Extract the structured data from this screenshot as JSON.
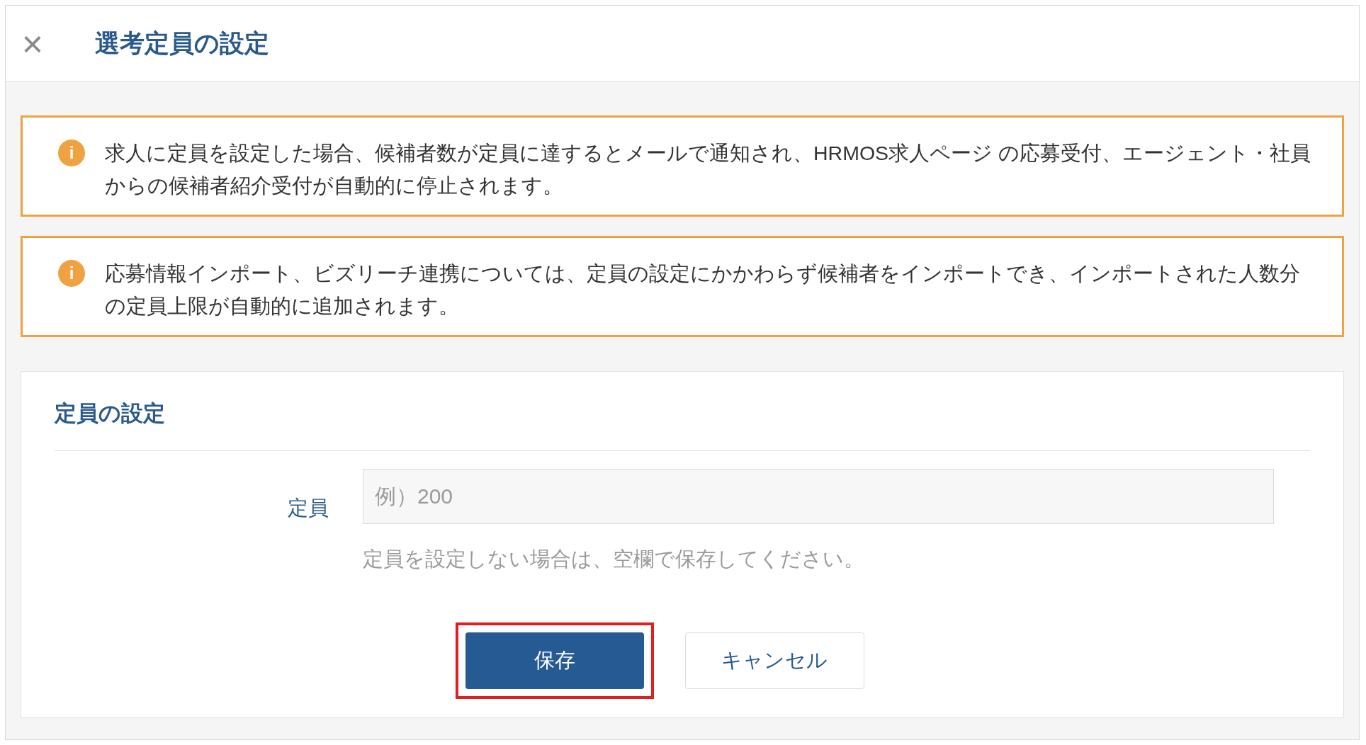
{
  "header": {
    "close": "×",
    "title": "選考定員の設定"
  },
  "notices": [
    {
      "icon": "i",
      "text": "求人に定員を設定した場合、候補者数が定員に達するとメールで通知され、HRMOS求人ページ の応募受付、エージェント・社員からの候補者紹介受付が自動的に停止されます。"
    },
    {
      "icon": "i",
      "text": "応募情報インポート、ビズリーチ連携については、定員の設定にかかわらず候補者をインポートでき、インポートされた人数分の定員上限が自動的に追加されます。"
    }
  ],
  "form": {
    "title": "定員の設定",
    "field": {
      "label": "定員",
      "placeholder": "例）200",
      "help": "定員を設定しない場合は、空欄で保存してください。"
    },
    "buttons": [
      {
        "kind": "primary",
        "label": "保存",
        "highlighted": true
      },
      {
        "kind": "secondary",
        "label": "キャンセル",
        "highlighted": false
      }
    ]
  }
}
